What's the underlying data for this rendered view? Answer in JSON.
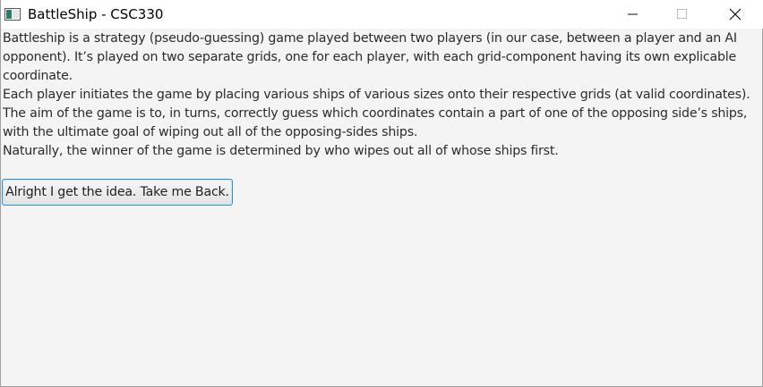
{
  "window": {
    "title": "BattleShip - CSC330",
    "icon": "app-window-icon",
    "controls": {
      "minimize_icon": "minimize-icon",
      "maximize_icon": "maximize-icon",
      "close_icon": "close-icon"
    }
  },
  "content": {
    "lines": [
      "Battleship is a strategy (pseudo-guessing) game played between two players (in our case, between a player and an AI",
      "opponent). It’s played on two separate grids, one for each player, with each grid-component having its own explicable",
      "coordinate.",
      "Each player initiates the game by placing various ships of various sizes onto their respective grids (at valid coordinates).",
      "The aim of the game is to, in turns, correctly guess which coordinates contain a part of one of the opposing side’s ships,",
      "with the ultimate goal of wiping out all of the opposing-sides ships.",
      "Naturally, the winner of the game is determined by who wipes out all of whose ships first."
    ]
  },
  "back_button": {
    "label": "Alright I get the idea. Take me Back."
  },
  "colors": {
    "background": "#f4f4f4",
    "titlebar": "#ffffff",
    "button_focus_border": "#2f8fd6",
    "text": "#2b2b2b"
  }
}
